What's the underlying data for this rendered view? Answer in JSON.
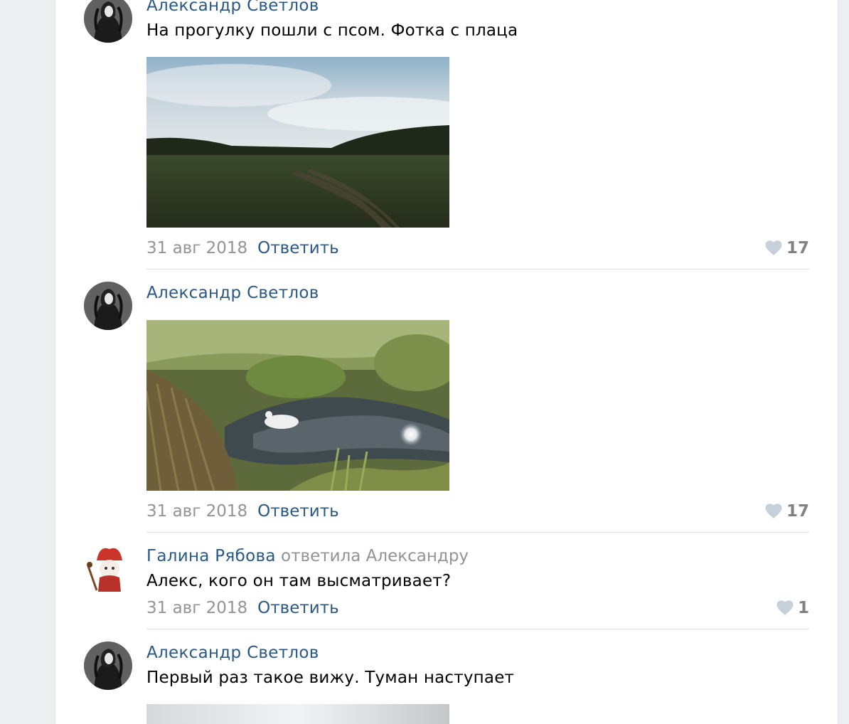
{
  "comments": [
    {
      "author": "Александр Светлов",
      "text": "На прогулку пошли с псом. Фотка с плаца",
      "date": "31 авг 2018",
      "reply": "Ответить",
      "likes": "17"
    },
    {
      "author": "Александр Светлов",
      "date": "31 авг 2018",
      "reply": "Ответить",
      "likes": "17"
    },
    {
      "author": "Галина Рябова",
      "replied_to": "ответила Александру",
      "text": "Алекс, кого он там высматривает?",
      "date": "31 авг 2018",
      "reply": "Ответить",
      "likes": "1"
    },
    {
      "author": "Александр Светлов",
      "text": "Первый раз такое вижу. Туман наступает"
    }
  ],
  "colors": {
    "link": "#2a5885",
    "muted": "#939393",
    "background": "#edeef0",
    "like_icon": "#c5d0db"
  },
  "icons": {
    "like": "heart-icon",
    "avatar_1": "dark-figure-avatar",
    "avatar_2": "red-hooded-cat-avatar"
  }
}
